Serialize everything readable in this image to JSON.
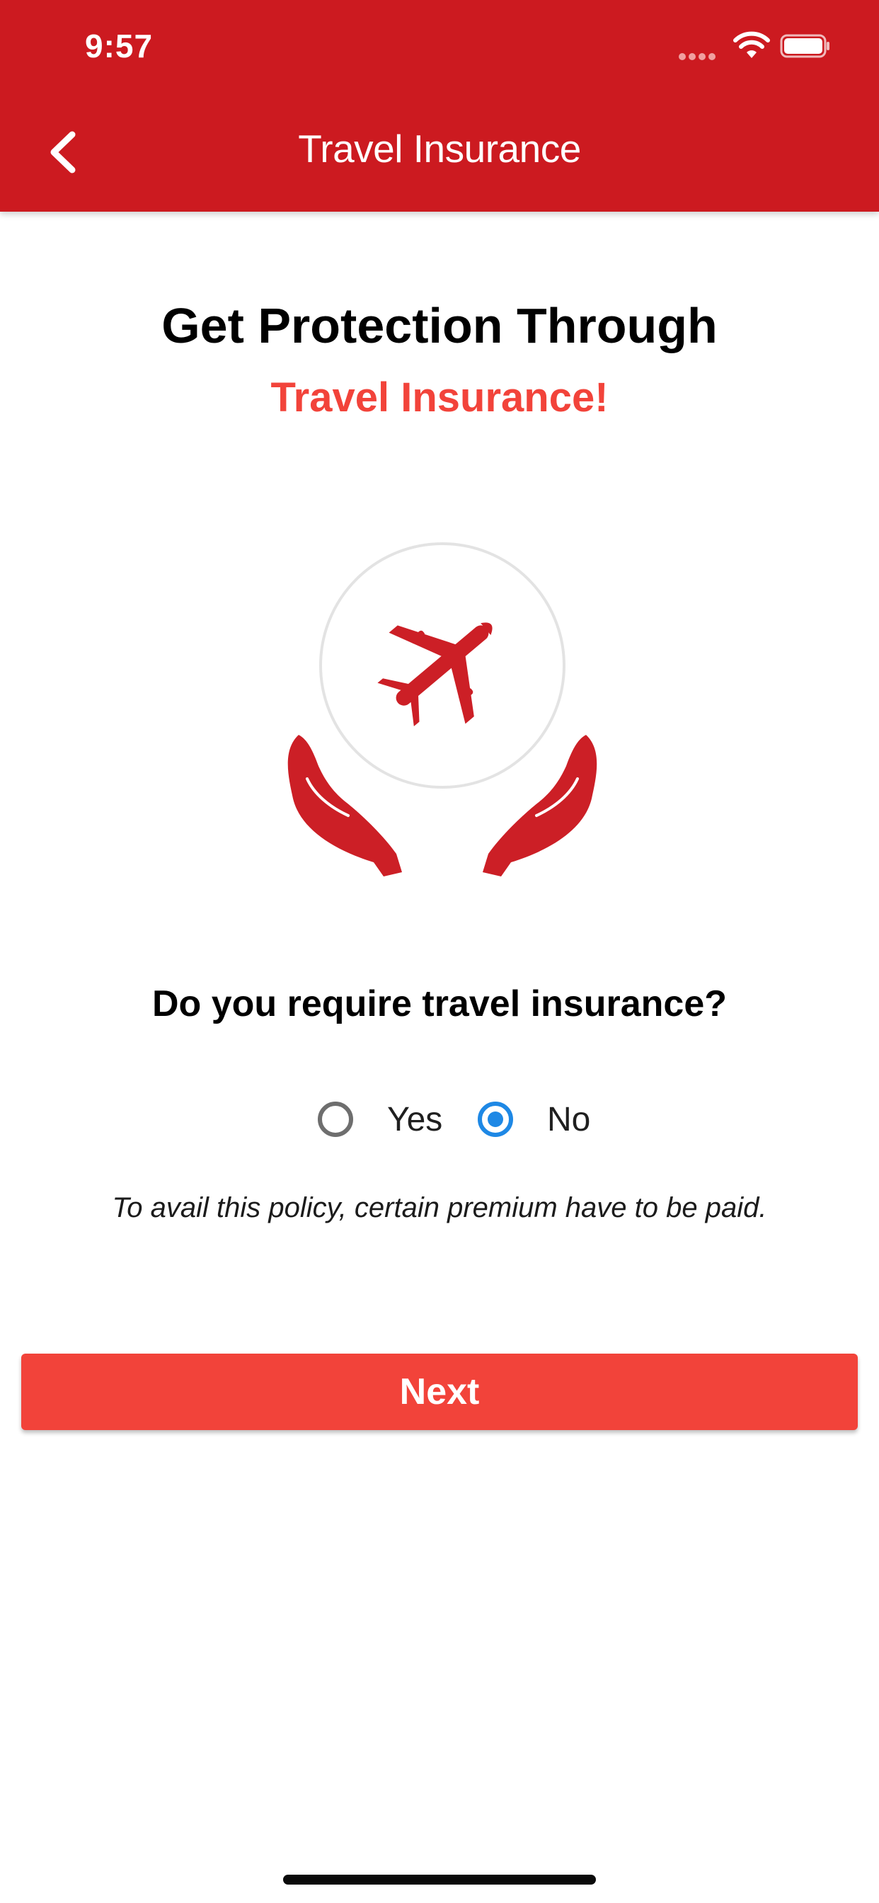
{
  "status_bar": {
    "time": "9:57",
    "icons": [
      "signal-dots-icon",
      "wifi-icon",
      "battery-icon"
    ]
  },
  "header": {
    "title": "Travel Insurance",
    "back_icon": "chevron-left-icon"
  },
  "main": {
    "headline": "Get Protection Through",
    "subheadline": "Travel Insurance!",
    "illustration_icon": "hands-holding-plane-icon",
    "question": "Do you require travel insurance?",
    "options": [
      {
        "label": "Yes",
        "selected": false
      },
      {
        "label": "No",
        "selected": true
      }
    ],
    "note": "To avail this policy, certain premium have to be paid.",
    "next_label": "Next"
  },
  "colors": {
    "header_red": "#cc1a20",
    "accent_red": "#f2433a",
    "illustration_red": "#cc1f26",
    "radio_selected": "#1e88e5",
    "radio_unselected": "#6e6e6e"
  }
}
